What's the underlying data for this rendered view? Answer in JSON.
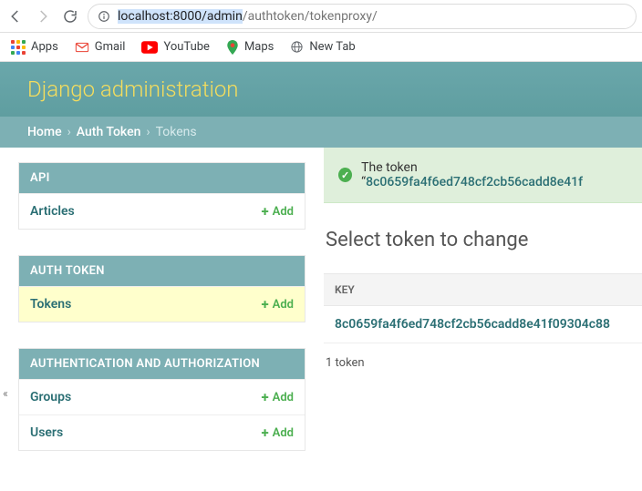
{
  "browser": {
    "url_host": "localhost:8000/admin",
    "url_path": "/authtoken/tokenproxy/",
    "bookmarks": {
      "apps": "Apps",
      "gmail": "Gmail",
      "youtube": "YouTube",
      "maps": "Maps",
      "newtab": "New Tab"
    }
  },
  "header": {
    "title": "Django administration"
  },
  "breadcrumbs": {
    "home": "Home",
    "section": "Auth Token",
    "current": "Tokens"
  },
  "sidebar": {
    "modules": [
      {
        "title": "API",
        "rows": [
          {
            "label": "Articles",
            "add": "Add"
          }
        ]
      },
      {
        "title": "AUTH TOKEN",
        "rows": [
          {
            "label": "Tokens",
            "add": "Add",
            "highlight": true
          }
        ]
      },
      {
        "title": "AUTHENTICATION AND AUTHORIZATION",
        "rows": [
          {
            "label": "Groups",
            "add": "Add"
          },
          {
            "label": "Users",
            "add": "Add"
          }
        ]
      }
    ]
  },
  "message": {
    "prefix": "The token “",
    "token": "8c0659fa4f6ed748cf2cb56cadd8e41f"
  },
  "page": {
    "title": "Select token to change",
    "col_key": "KEY",
    "rows": [
      {
        "key": "8c0659fa4f6ed748cf2cb56cadd8e41f09304c88"
      }
    ],
    "count": "1 token"
  }
}
